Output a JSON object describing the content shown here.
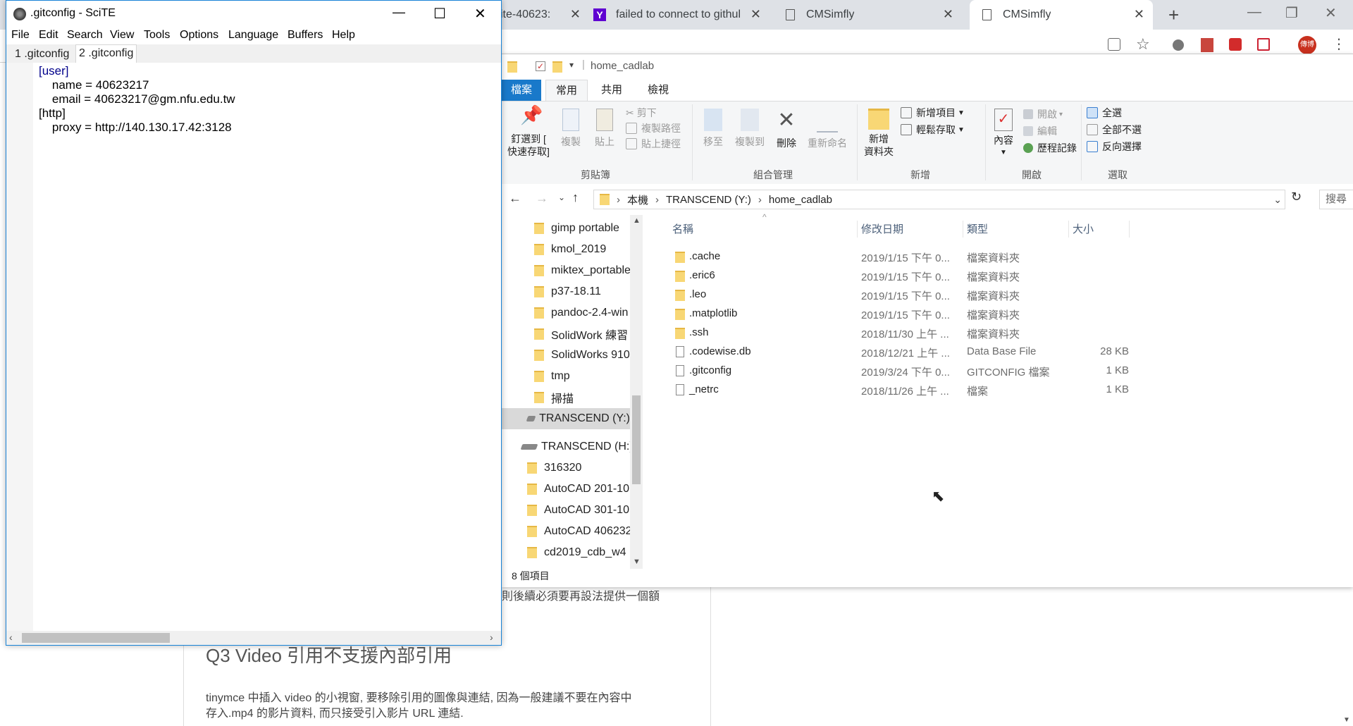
{
  "chrome": {
    "tabs": [
      {
        "label": "ite-40623:"
      },
      {
        "label": "failed to connect to githul"
      },
      {
        "label": "CMSimfly"
      },
      {
        "label": "CMSimfly"
      }
    ],
    "new_tab": "+",
    "min": "—",
    "max": "❐",
    "close": "✕",
    "avatar": "傳博"
  },
  "web": {
    "para1_tail": "則後續必須要再設法提供一個額",
    "heading": "Q3 Video 引用不支援內部引用",
    "para2_line1": "tinymce 中插入 video 的小視窗, 要移除引用的圖像與連結, 因為一般建議不要在內容中",
    "para2_line2": "存入.mp4 的影片資料, 而只接受引入影片 URL 連結."
  },
  "explorer": {
    "title": "home_cadlab",
    "tabs": {
      "file": "檔案",
      "home": "常用",
      "share": "共用",
      "view": "檢視"
    },
    "ribbon": {
      "pin": "釘選到 [",
      "pin2": "快速存取]",
      "copy": "複製",
      "paste": "貼上",
      "cut": "剪下",
      "copy_path": "複製路徑",
      "paste_shortcut": "貼上捷徑",
      "group_clipboard": "剪貼簿",
      "move_to": "移至",
      "copy_to": "複製到",
      "delete": "刪除",
      "rename": "重新命名",
      "group_organize": "組合管理",
      "new_folder": "新增",
      "new_folder2": "資料夾",
      "new_item": "新增項目",
      "easy_access": "輕鬆存取",
      "group_new": "新增",
      "properties": "內容",
      "open": "開啟",
      "edit": "編輯",
      "history": "歷程記錄",
      "group_open": "開啟",
      "select_all": "全選",
      "select_none": "全部不選",
      "invert": "反向選擇",
      "group_select": "選取"
    },
    "address": {
      "root": "本機",
      "drive": "TRANSCEND (Y:)",
      "folder": "home_cadlab"
    },
    "search_placeholder": "搜尋",
    "nav": [
      "gimp portable",
      "kmol_2019",
      "miktex_portable",
      "p37-18.11",
      "pandoc-2.4-win",
      "SolidWork 練習",
      "SolidWorks 910",
      "tmp",
      "掃描",
      "TRANSCEND (Y:)",
      "TRANSCEND (H:)",
      "316320",
      "AutoCAD 201-10",
      "AutoCAD 301-10",
      "AutoCAD 406232",
      "cd2019_cdb_w4"
    ],
    "columns": {
      "name": "名稱",
      "date": "修改日期",
      "type": "類型",
      "size": "大小"
    },
    "files": [
      {
        "name": ".cache",
        "date": "2019/1/15 下午 0...",
        "type": "檔案資料夾",
        "size": ""
      },
      {
        "name": ".eric6",
        "date": "2019/1/15 下午 0...",
        "type": "檔案資料夾",
        "size": ""
      },
      {
        "name": ".leo",
        "date": "2019/1/15 下午 0...",
        "type": "檔案資料夾",
        "size": ""
      },
      {
        "name": ".matplotlib",
        "date": "2019/1/15 下午 0...",
        "type": "檔案資料夾",
        "size": ""
      },
      {
        "name": ".ssh",
        "date": "2018/11/30 上午 ...",
        "type": "檔案資料夾",
        "size": ""
      },
      {
        "name": ".codewise.db",
        "date": "2018/12/21 上午 ...",
        "type": "Data Base File",
        "size": "28 KB"
      },
      {
        "name": ".gitconfig",
        "date": "2019/3/24 下午 0...",
        "type": "GITCONFIG 檔案",
        "size": "1 KB"
      },
      {
        "name": "_netrc",
        "date": "2018/11/26 上午 ...",
        "type": "檔案",
        "size": "1 KB"
      }
    ],
    "status": "8 個項目"
  },
  "scite": {
    "title": ".gitconfig - SciTE",
    "menu": [
      "File",
      "Edit",
      "Search",
      "View",
      "Tools",
      "Options",
      "Language",
      "Buffers",
      "Help"
    ],
    "tabs": [
      "1 .gitconfig",
      "2 .gitconfig"
    ],
    "lines": [
      "[user]",
      "    name = 40623217",
      "    email = 40623217@gm.nfu.edu.tw",
      "[http]",
      "    proxy = http://140.130.17.42:3128"
    ],
    "min": "—",
    "max": "☐",
    "close": "✕"
  }
}
